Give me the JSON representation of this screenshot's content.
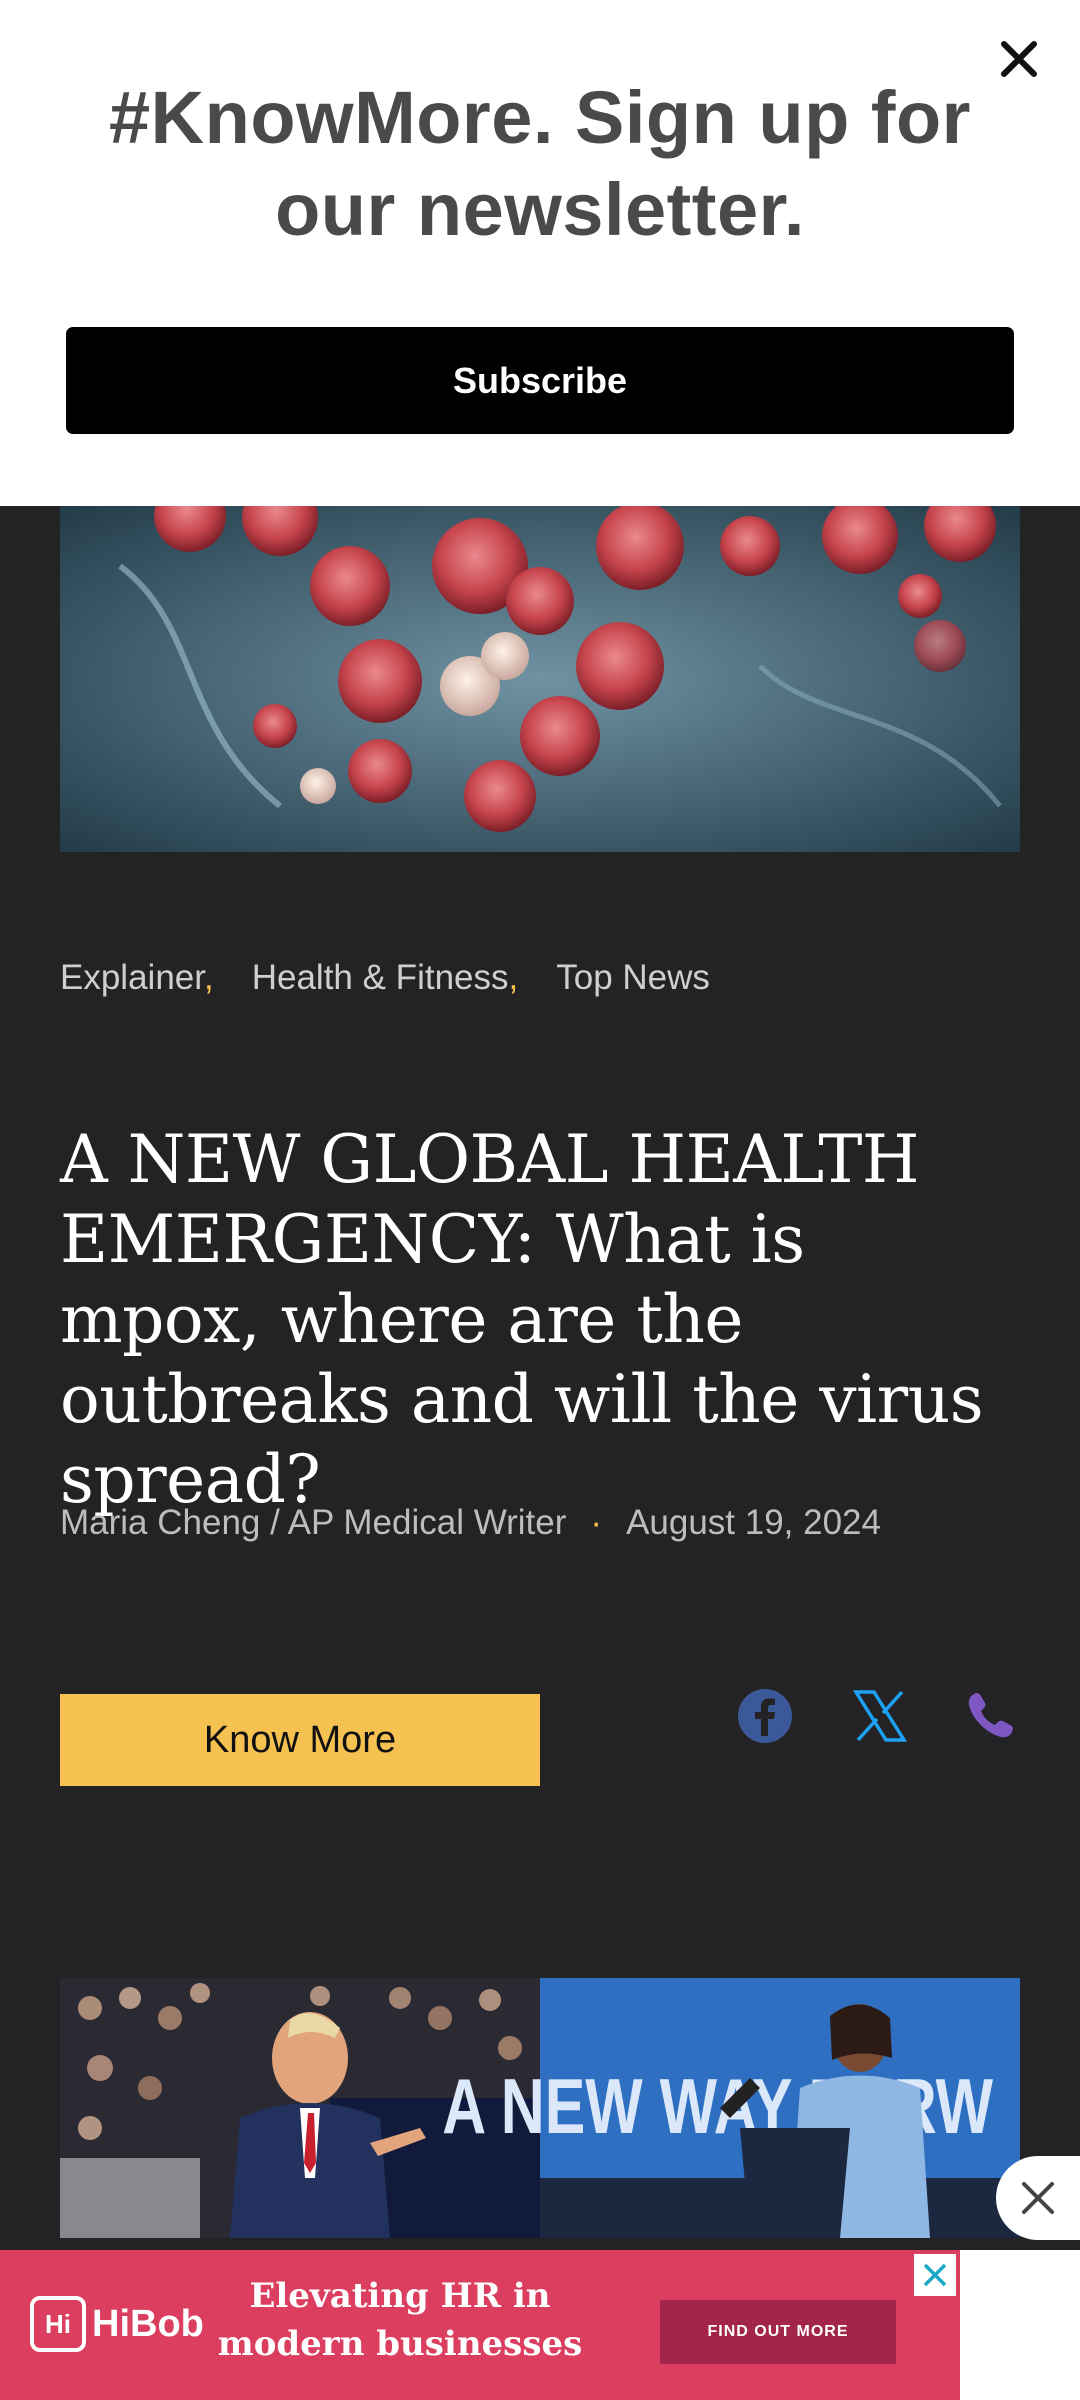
{
  "popup": {
    "title": "#KnowMore. Sign up for our newsletter.",
    "subscribe_label": "Subscribe"
  },
  "article": {
    "categories": [
      "Explainer",
      "Health & Fitness",
      "Top News"
    ],
    "headline": "A NEW GLOBAL HEALTH EMERGENCY: What is mpox, where are the outbreaks and will the virus spread?",
    "author": "Maria Cheng / AP Medical Writer",
    "date": "August 19, 2024",
    "know_more_label": "Know More"
  },
  "share": {
    "icons": [
      "facebook-icon",
      "x-icon",
      "phone-icon"
    ],
    "colors": {
      "facebook": "#3b5998",
      "x": "#1da1f2",
      "phone": "#7e57c2"
    }
  },
  "ad": {
    "brand": "HiBob",
    "text": "Elevating HR in modern businesses",
    "cta": "FIND OUT MORE"
  },
  "colors": {
    "background": "#232325",
    "accent": "#f5c150",
    "ad_background": "#db3e5e"
  }
}
